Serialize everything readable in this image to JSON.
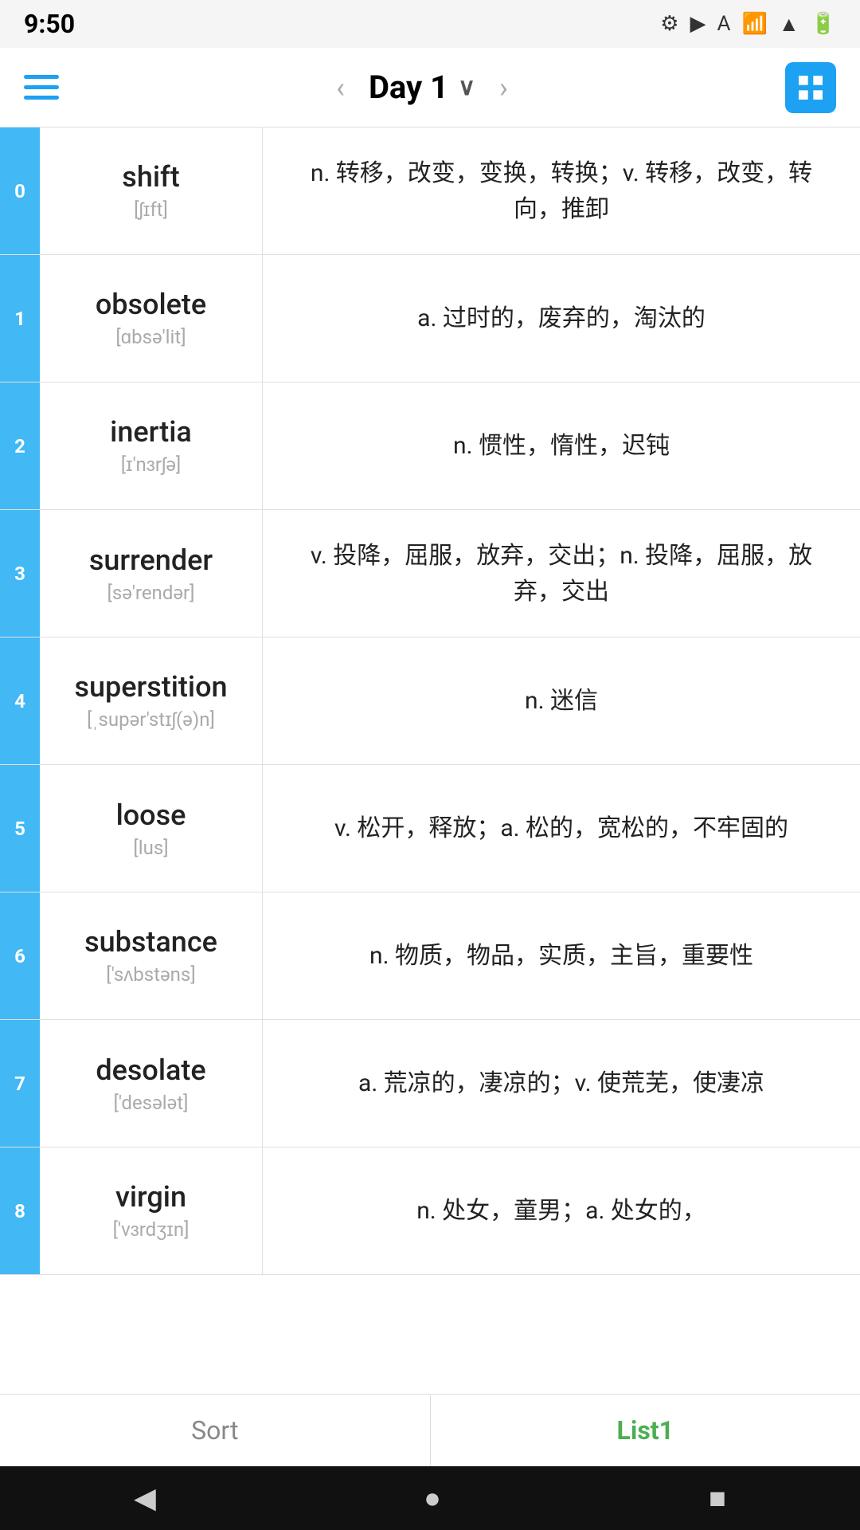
{
  "statusBar": {
    "time": "9:50",
    "icons": [
      "⚙",
      "▶",
      "A",
      "?",
      "•",
      "▲",
      "🔋"
    ]
  },
  "topNav": {
    "title": "Day 1",
    "prevLabel": "‹",
    "nextLabel": "›"
  },
  "words": [
    {
      "index": "0",
      "word": "shift",
      "phonetic": "[ʃɪft]",
      "definition": "n. 转移，改变，变换，转换；v. 转移，改变，转向，推卸"
    },
    {
      "index": "1",
      "word": "obsolete",
      "phonetic": "[ɑbsə'lit]",
      "definition": "a. 过时的，废弃的，淘汰的"
    },
    {
      "index": "2",
      "word": "inertia",
      "phonetic": "[ɪ'nɜrʃə]",
      "definition": "n. 惯性，惰性，迟钝"
    },
    {
      "index": "3",
      "word": "surrender",
      "phonetic": "[sə'rendər]",
      "definition": "v. 投降，屈服，放弃，交出；n. 投降，屈服，放弃，交出"
    },
    {
      "index": "4",
      "word": "superstition",
      "phonetic": "[ˌsupər'stɪʃ(ə)n]",
      "definition": "n. 迷信"
    },
    {
      "index": "5",
      "word": "loose",
      "phonetic": "[lus]",
      "definition": "v. 松开，释放；a. 松的，宽松的，不牢固的"
    },
    {
      "index": "6",
      "word": "substance",
      "phonetic": "['sʌbstəns]",
      "definition": "n. 物质，物品，实质，主旨，重要性"
    },
    {
      "index": "7",
      "word": "desolate",
      "phonetic": "['desələt]",
      "definition": "a. 荒凉的，凄凉的；v. 使荒芜，使凄凉"
    },
    {
      "index": "8",
      "word": "virgin",
      "phonetic": "['vɜrdʒɪn]",
      "definition": "n. 处女，童男；a. 处女的，"
    }
  ],
  "bottomTabs": {
    "sort": "Sort",
    "list1": "List1"
  },
  "sysNav": {
    "back": "◀",
    "home": "●",
    "recent": "■"
  }
}
